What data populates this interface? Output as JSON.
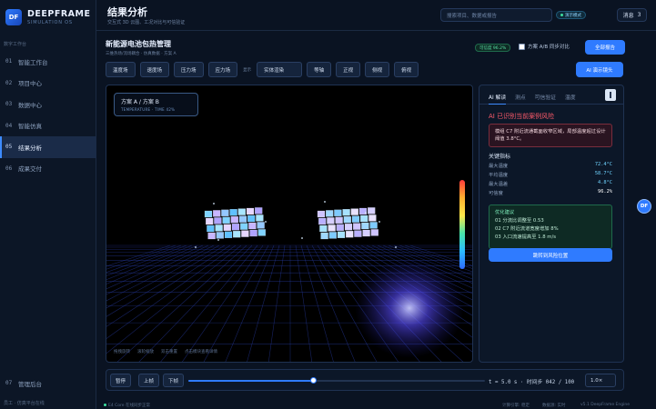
{
  "app": {
    "logo_mark": "DF",
    "name": "DEEPFRAME",
    "tagline": "SIMULATION OS"
  },
  "sidebar": {
    "group_label": "数字工作台",
    "items": [
      {
        "num": "01",
        "label": "智能工作台"
      },
      {
        "num": "02",
        "label": "项目中心"
      },
      {
        "num": "03",
        "label": "数据中心"
      },
      {
        "num": "04",
        "label": "智能仿真"
      },
      {
        "num": "05",
        "label": "结果分析"
      },
      {
        "num": "06",
        "label": "成果交付"
      }
    ],
    "bottom_item": {
      "num": "07",
      "label": "管理后台"
    },
    "footer": "员工 · 仿真平台在线"
  },
  "header": {
    "title": "结果分析",
    "subtitle": "交互式 3D 云图、工况对比与可信验证",
    "search_placeholder": "搜索项目、数据或报告",
    "demo_badge": "演示模式",
    "messages_label": "消息",
    "messages_count": "3"
  },
  "project": {
    "title": "新能源电池包热管理",
    "subtitle": "三维热场/流场耦合 · 仿真数据 · 方案 A",
    "confidence": "可信度 96.2%",
    "compare_label": "方案 A/B 同步对比",
    "full_report": "全部报告"
  },
  "toolbar": {
    "field_buttons": [
      "温度场",
      "速度场",
      "压力场",
      "应力场"
    ],
    "display_label": "显示",
    "display_mode": "实体渲染",
    "view_buttons": [
      "等轴",
      "正视",
      "侧视",
      "俯视"
    ],
    "ai_lens": "AI 演示镜头"
  },
  "viewport": {
    "legend_title": "方案 A  /  方案 B",
    "legend_sub": "TEMPERATURE  ·  TIME 42%",
    "footer_items": [
      "拖拽旋转",
      "滚轮缩放",
      "双击重置",
      "点击模块查看详情"
    ]
  },
  "panel": {
    "tabs": [
      "AI 解读",
      "测点",
      "可信验证",
      "温度"
    ],
    "risk_title": "AI 已识别当前案例风险",
    "risk_text": "模组 C7 附近流通截面收窄区域，局部温度超过设计阈值 3.8°C。",
    "metrics_title": "关键指标",
    "metrics": [
      {
        "label": "最大温度",
        "value": "72.4°C"
      },
      {
        "label": "平均温度",
        "value": "58.7°C"
      },
      {
        "label": "最大温差",
        "value": "4.8°C"
      },
      {
        "label": "可信度",
        "value": "96.2%"
      }
    ],
    "advice_title": "优化建议",
    "advice": [
      "01  分流比调整至 0.53",
      "02  C7 附近流道宽度增加 8%",
      "03  入口流速提高至 1.8 m/s"
    ],
    "locate_button": "跳转到风险位置"
  },
  "playback": {
    "pause": "暂停",
    "prev": "上帧",
    "next": "下帧",
    "progress": 0.42,
    "time_text": "t = 5.0 s · 时间步 042 / 100",
    "speed": "1.0×"
  },
  "statusbar": {
    "left": "E4 Core 在线同步正常",
    "mid1": "计算引擎: 稳定",
    "mid2": "数据源: 实时",
    "right": "v5.1 DeepFrame Engine"
  },
  "float_button": "DF"
}
